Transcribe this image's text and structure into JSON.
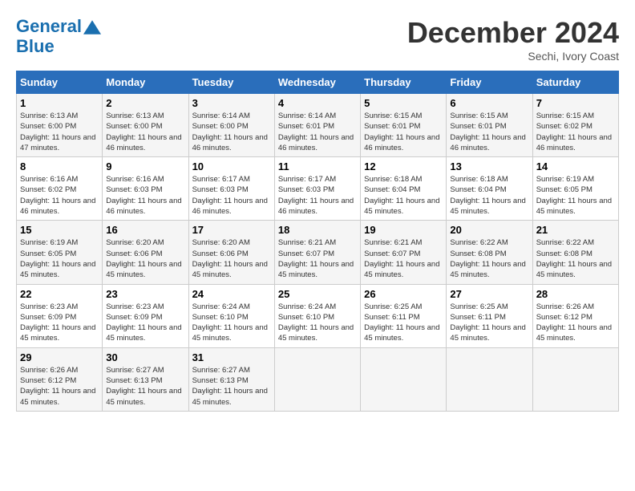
{
  "header": {
    "logo_line1": "General",
    "logo_line2": "Blue",
    "month_title": "December 2024",
    "subtitle": "Sechi, Ivory Coast"
  },
  "weekdays": [
    "Sunday",
    "Monday",
    "Tuesday",
    "Wednesday",
    "Thursday",
    "Friday",
    "Saturday"
  ],
  "weeks": [
    [
      {
        "day": "1",
        "sunrise": "6:13 AM",
        "sunset": "6:00 PM",
        "daylight": "11 hours and 47 minutes."
      },
      {
        "day": "2",
        "sunrise": "6:13 AM",
        "sunset": "6:00 PM",
        "daylight": "11 hours and 46 minutes."
      },
      {
        "day": "3",
        "sunrise": "6:14 AM",
        "sunset": "6:00 PM",
        "daylight": "11 hours and 46 minutes."
      },
      {
        "day": "4",
        "sunrise": "6:14 AM",
        "sunset": "6:01 PM",
        "daylight": "11 hours and 46 minutes."
      },
      {
        "day": "5",
        "sunrise": "6:15 AM",
        "sunset": "6:01 PM",
        "daylight": "11 hours and 46 minutes."
      },
      {
        "day": "6",
        "sunrise": "6:15 AM",
        "sunset": "6:01 PM",
        "daylight": "11 hours and 46 minutes."
      },
      {
        "day": "7",
        "sunrise": "6:15 AM",
        "sunset": "6:02 PM",
        "daylight": "11 hours and 46 minutes."
      }
    ],
    [
      {
        "day": "8",
        "sunrise": "6:16 AM",
        "sunset": "6:02 PM",
        "daylight": "11 hours and 46 minutes."
      },
      {
        "day": "9",
        "sunrise": "6:16 AM",
        "sunset": "6:03 PM",
        "daylight": "11 hours and 46 minutes."
      },
      {
        "day": "10",
        "sunrise": "6:17 AM",
        "sunset": "6:03 PM",
        "daylight": "11 hours and 46 minutes."
      },
      {
        "day": "11",
        "sunrise": "6:17 AM",
        "sunset": "6:03 PM",
        "daylight": "11 hours and 46 minutes."
      },
      {
        "day": "12",
        "sunrise": "6:18 AM",
        "sunset": "6:04 PM",
        "daylight": "11 hours and 45 minutes."
      },
      {
        "day": "13",
        "sunrise": "6:18 AM",
        "sunset": "6:04 PM",
        "daylight": "11 hours and 45 minutes."
      },
      {
        "day": "14",
        "sunrise": "6:19 AM",
        "sunset": "6:05 PM",
        "daylight": "11 hours and 45 minutes."
      }
    ],
    [
      {
        "day": "15",
        "sunrise": "6:19 AM",
        "sunset": "6:05 PM",
        "daylight": "11 hours and 45 minutes."
      },
      {
        "day": "16",
        "sunrise": "6:20 AM",
        "sunset": "6:06 PM",
        "daylight": "11 hours and 45 minutes."
      },
      {
        "day": "17",
        "sunrise": "6:20 AM",
        "sunset": "6:06 PM",
        "daylight": "11 hours and 45 minutes."
      },
      {
        "day": "18",
        "sunrise": "6:21 AM",
        "sunset": "6:07 PM",
        "daylight": "11 hours and 45 minutes."
      },
      {
        "day": "19",
        "sunrise": "6:21 AM",
        "sunset": "6:07 PM",
        "daylight": "11 hours and 45 minutes."
      },
      {
        "day": "20",
        "sunrise": "6:22 AM",
        "sunset": "6:08 PM",
        "daylight": "11 hours and 45 minutes."
      },
      {
        "day": "21",
        "sunrise": "6:22 AM",
        "sunset": "6:08 PM",
        "daylight": "11 hours and 45 minutes."
      }
    ],
    [
      {
        "day": "22",
        "sunrise": "6:23 AM",
        "sunset": "6:09 PM",
        "daylight": "11 hours and 45 minutes."
      },
      {
        "day": "23",
        "sunrise": "6:23 AM",
        "sunset": "6:09 PM",
        "daylight": "11 hours and 45 minutes."
      },
      {
        "day": "24",
        "sunrise": "6:24 AM",
        "sunset": "6:10 PM",
        "daylight": "11 hours and 45 minutes."
      },
      {
        "day": "25",
        "sunrise": "6:24 AM",
        "sunset": "6:10 PM",
        "daylight": "11 hours and 45 minutes."
      },
      {
        "day": "26",
        "sunrise": "6:25 AM",
        "sunset": "6:11 PM",
        "daylight": "11 hours and 45 minutes."
      },
      {
        "day": "27",
        "sunrise": "6:25 AM",
        "sunset": "6:11 PM",
        "daylight": "11 hours and 45 minutes."
      },
      {
        "day": "28",
        "sunrise": "6:26 AM",
        "sunset": "6:12 PM",
        "daylight": "11 hours and 45 minutes."
      }
    ],
    [
      {
        "day": "29",
        "sunrise": "6:26 AM",
        "sunset": "6:12 PM",
        "daylight": "11 hours and 45 minutes."
      },
      {
        "day": "30",
        "sunrise": "6:27 AM",
        "sunset": "6:13 PM",
        "daylight": "11 hours and 45 minutes."
      },
      {
        "day": "31",
        "sunrise": "6:27 AM",
        "sunset": "6:13 PM",
        "daylight": "11 hours and 45 minutes."
      },
      null,
      null,
      null,
      null
    ]
  ]
}
